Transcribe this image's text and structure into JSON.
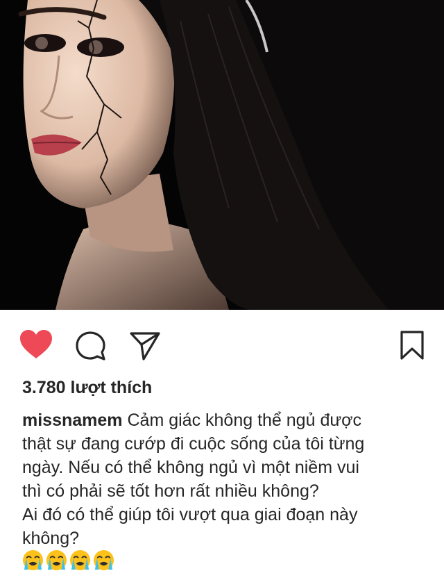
{
  "post": {
    "photo": {
      "description_icon": "portrait-photo"
    },
    "actions": {
      "like_icon": "heart-icon",
      "comment_icon": "comment-icon",
      "share_icon": "send-icon",
      "save_icon": "bookmark-icon",
      "like_color": "#ed4956"
    },
    "likes_text": "3.780 lượt thích",
    "caption": {
      "username": "missnamem",
      "text_line1": "Cảm giác không thể ngủ được",
      "text_rest": "thật sự đang cướp đi cuộc sống của tôi từng\nngày. Nếu có thể không ngủ vì một niềm vui\nthì có phải sẽ tốt hơn rất nhiều không?\nAi đó có thể giúp tôi vượt qua giai đoạn này\nkhông?"
    },
    "emojis": [
      "loudly-crying-face",
      "loudly-crying-face",
      "loudly-crying-face",
      "loudly-crying-face"
    ]
  }
}
